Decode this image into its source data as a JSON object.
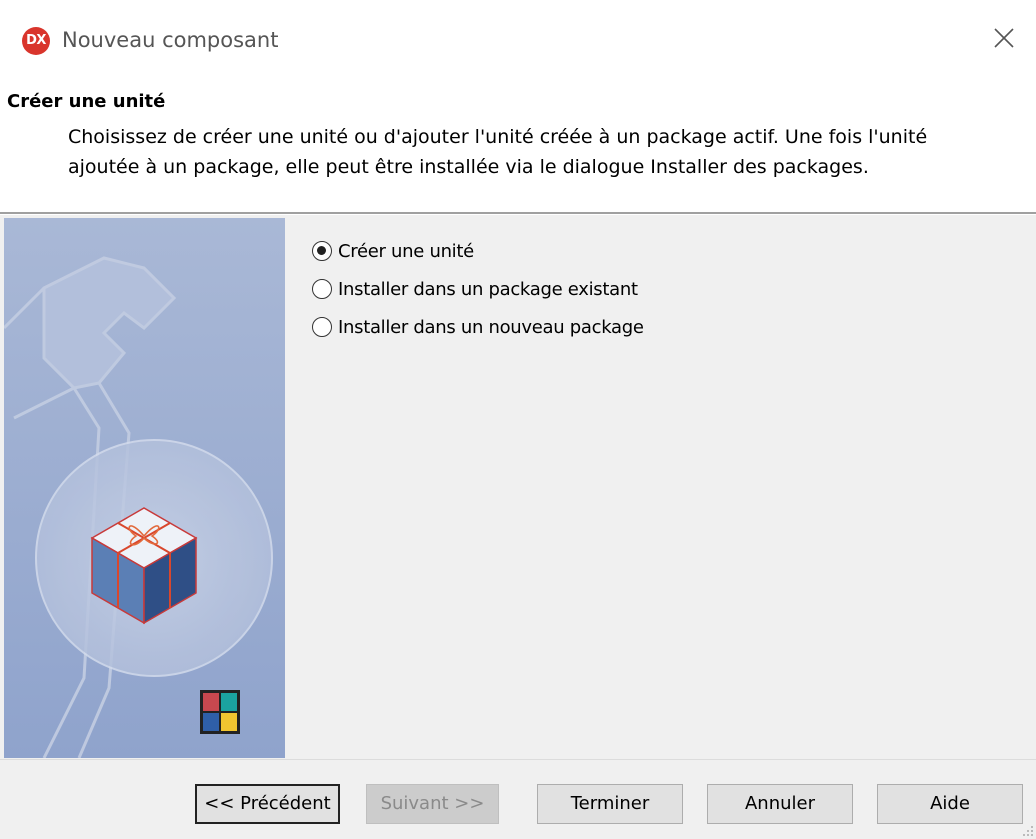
{
  "window": {
    "app_icon_label": "DX",
    "title": "Nouveau composant",
    "close_label": "×"
  },
  "header": {
    "title": "Créer une unité",
    "description": "Choisissez de créer une unité ou d'ajouter l'unité créée à un package actif. Une fois l'unité ajoutée à un package, elle peut être installée via le dialogue Installer des packages."
  },
  "options": [
    {
      "label": "Créer une unité",
      "checked": true
    },
    {
      "label": "Installer dans un package existant",
      "checked": false
    },
    {
      "label": "Installer dans un nouveau package",
      "checked": false
    }
  ],
  "buttons": {
    "previous": "<< Précédent",
    "next": "Suivant >>",
    "finish": "Terminer",
    "cancel": "Annuler",
    "help": "Aide"
  },
  "colors": {
    "app_icon": "#d9352c",
    "side_panel_top": "#a9b8d6",
    "side_panel_bottom": "#8fa3cc",
    "box_top": "#eef2f8",
    "box_left": "#5b7fb5",
    "box_right": "#2f4f86",
    "ribbon": "#d9472c"
  },
  "icons": [
    "app-logo-icon",
    "close-icon",
    "wrench-illustration",
    "gift-box-illustration",
    "color-grid-icon",
    "resize-grip-icon"
  ]
}
